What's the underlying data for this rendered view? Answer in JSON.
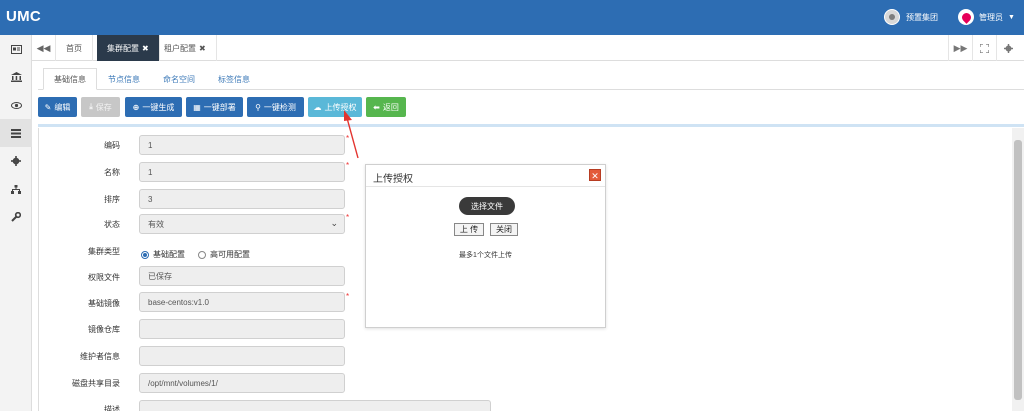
{
  "header": {
    "logo": "UMC",
    "company": "预置集团",
    "user": "管理员",
    "colors": {
      "header_bg": "#2d6db3",
      "active_tab_bg": "#2b3a4b"
    }
  },
  "sidebar": {
    "icons": [
      "id-card-icon",
      "bank-icon",
      "eye-icon",
      "list-icon",
      "gear-icon",
      "sitemap-icon",
      "wrench-icon"
    ]
  },
  "tabs": {
    "home": "首页",
    "cluster": "集群配置",
    "tenant": "租户配置",
    "close_mark": "✖"
  },
  "subtabs": [
    "基础信息",
    "节点信息",
    "命名空间",
    "标签信息"
  ],
  "toolbar": {
    "edit": "编辑",
    "save": "保存",
    "generate": "一键生成",
    "deploy": "一键部署",
    "check": "一键检测",
    "upload_auth": "上传授权",
    "back": "返回"
  },
  "form": {
    "code_label": "编码",
    "code_value": "1",
    "name_label": "名称",
    "name_value": "1",
    "sort_label": "排序",
    "sort_value": "3",
    "status_label": "状态",
    "status_value": "有效",
    "cluster_type_label": "集群类型",
    "cluster_type_options": [
      "基础配置",
      "高可用配置"
    ],
    "cluster_type_selected": "基础配置",
    "license_label": "权限文件",
    "license_value": "已保存",
    "base_image_label": "基础镜像",
    "base_image_value": "base-centos:v1.0",
    "image_repo_label": "镜像仓库",
    "image_repo_value": "",
    "maintainer_label": "维护者信息",
    "maintainer_value": "",
    "shared_dir_label": "磁盘共享目录",
    "shared_dir_value": "/opt/mnt/volumes/1/",
    "desc_label": "描述",
    "required_mark": "*"
  },
  "dialog": {
    "title": "上传授权",
    "choose_file": "选择文件",
    "upload": "上 传",
    "close": "关闭",
    "tip": "最多1个文件上传"
  }
}
